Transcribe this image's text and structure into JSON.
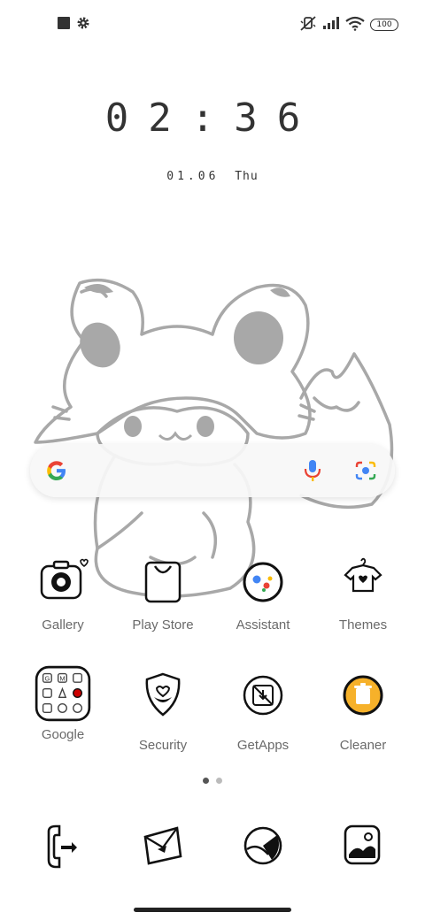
{
  "status_bar": {
    "left_icons": [
      "square-notification-icon",
      "gear-icon"
    ],
    "right_icons": [
      "mute-icon",
      "signal-icon",
      "wifi-icon",
      "battery-icon"
    ],
    "battery": "100"
  },
  "clock": {
    "time": "02:36",
    "date": "01.06",
    "day": "Thu"
  },
  "search": {
    "icons": [
      "google-g-icon",
      "microphone-icon",
      "lens-camera-icon"
    ]
  },
  "apps": [
    {
      "label": "Gallery",
      "icon": "camera-icon"
    },
    {
      "label": "Play Store",
      "icon": "shopping-bag-icon"
    },
    {
      "label": "Assistant",
      "icon": "assistant-dots-icon"
    },
    {
      "label": "Themes",
      "icon": "tshirt-icon"
    },
    {
      "label": "Google",
      "icon": "folder-icon"
    },
    {
      "label": "Security",
      "icon": "shield-heart-icon"
    },
    {
      "label": "GetApps",
      "icon": "getapps-icon"
    },
    {
      "label": "Cleaner",
      "icon": "trash-icon"
    }
  ],
  "page_indicator": {
    "pages": 2,
    "current": 1
  },
  "dock": [
    {
      "icon": "phone-icon"
    },
    {
      "icon": "message-envelope-icon"
    },
    {
      "icon": "browser-icon"
    },
    {
      "icon": "camera-photo-icon"
    }
  ],
  "colors": {
    "accent": "#4285F4",
    "cleaner_yellow": "#F6B12A"
  }
}
